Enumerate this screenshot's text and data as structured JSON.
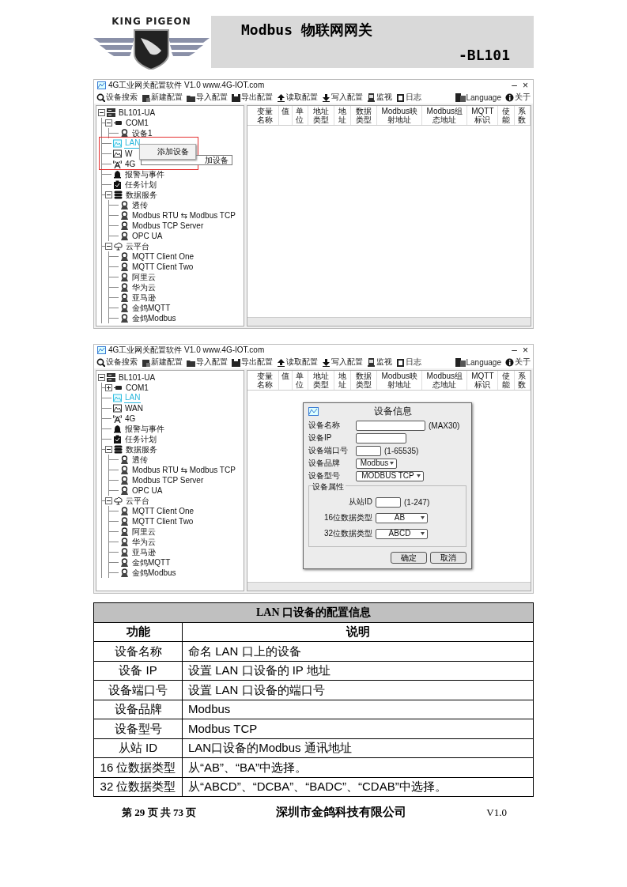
{
  "header": {
    "brand": "KING PIGEON",
    "title": "Modbus 物联网网关",
    "model": "-BL101"
  },
  "screenshots": [
    {
      "window_title": "4G工业网关配置软件 V1.0 www.4G-IOT.com",
      "window_controls": [
        "–",
        "×"
      ],
      "toolbar": [
        "设备搜索",
        "新建配置",
        "导入配置",
        "导出配置",
        "读取配置",
        "写入配置",
        "监视",
        "日志"
      ],
      "toolbar_right": [
        "Language",
        "关于"
      ],
      "tree": [
        {
          "label": "BL101-UA",
          "kind": "root",
          "selected": false,
          "expanded": true,
          "children": [
            {
              "label": "COM1",
              "kind": "serial",
              "selected": false,
              "expanded": true,
              "children": [
                {
                  "label": "设备1",
                  "kind": "device",
                  "selected": false
                }
              ]
            },
            {
              "label": "LAN",
              "kind": "lan",
              "selected": true
            },
            {
              "label": "W",
              "kind": "wan",
              "selected": false
            },
            {
              "label": "4G",
              "kind": "cell",
              "selected": false
            },
            {
              "label": "报警与事件",
              "kind": "alarm",
              "selected": false
            },
            {
              "label": "任务计划",
              "kind": "task",
              "selected": false
            },
            {
              "label": "数据服务",
              "kind": "database",
              "selected": false,
              "expanded": true,
              "children": [
                {
                  "label": "透传",
                  "kind": "device",
                  "selected": false
                },
                {
                  "label": "Modbus RTU ⇆ Modbus TCP",
                  "kind": "device",
                  "selected": false
                },
                {
                  "label": "Modbus TCP Server",
                  "kind": "device",
                  "selected": false
                },
                {
                  "label": "OPC UA",
                  "kind": "device",
                  "selected": false
                }
              ]
            },
            {
              "label": "云平台",
              "kind": "cloud",
              "selected": false,
              "expanded": true,
              "children": [
                {
                  "label": "MQTT Client One",
                  "kind": "device",
                  "selected": false
                },
                {
                  "label": "MQTT Client Two",
                  "kind": "device",
                  "selected": false
                },
                {
                  "label": "阿里云",
                  "kind": "device",
                  "selected": false
                },
                {
                  "label": "华为云",
                  "kind": "device",
                  "selected": false
                },
                {
                  "label": "亚马逊",
                  "kind": "device",
                  "selected": false
                },
                {
                  "label": "金鸽MQTT",
                  "kind": "device",
                  "selected": false
                },
                {
                  "label": "金鸽Modbus",
                  "kind": "device",
                  "selected": false
                }
              ]
            }
          ]
        }
      ],
      "columns": [
        "变量名称",
        "值",
        "单位",
        "地址类型",
        "地址",
        "数据类型",
        "Modbus映射地址",
        "Modbus组态地址",
        "MQTT标识",
        "使能",
        "系数"
      ],
      "context_menu": {
        "items": [
          "添加设备"
        ],
        "tooltip": "加设备"
      }
    },
    {
      "window_title": "4G工业网关配置软件 V1.0 www.4G-IOT.com",
      "window_controls": [
        "–",
        "×"
      ],
      "toolbar": [
        "设备搜索",
        "新建配置",
        "导入配置",
        "导出配置",
        "读取配置",
        "写入配置",
        "监视",
        "日志"
      ],
      "toolbar_right": [
        "Language",
        "关于"
      ],
      "tree": [
        {
          "label": "BL101-UA",
          "kind": "root",
          "selected": false,
          "expanded": true,
          "children": [
            {
              "label": "COM1",
              "kind": "serial",
              "selected": false,
              "expanded": false
            },
            {
              "label": "LAN",
              "kind": "lan",
              "selected": true
            },
            {
              "label": "WAN",
              "kind": "wan",
              "selected": false
            },
            {
              "label": "4G",
              "kind": "cell",
              "selected": false
            },
            {
              "label": "报警与事件",
              "kind": "alarm",
              "selected": false
            },
            {
              "label": "任务计划",
              "kind": "task",
              "selected": false
            },
            {
              "label": "数据服务",
              "kind": "database",
              "selected": false,
              "expanded": true,
              "children": [
                {
                  "label": "透传",
                  "kind": "device",
                  "selected": false
                },
                {
                  "label": "Modbus RTU ⇆ Modbus TCP",
                  "kind": "device",
                  "selected": false
                },
                {
                  "label": "Modbus TCP Server",
                  "kind": "device",
                  "selected": false
                },
                {
                  "label": "OPC UA",
                  "kind": "device",
                  "selected": false
                }
              ]
            },
            {
              "label": "云平台",
              "kind": "cloud",
              "selected": false,
              "expanded": true,
              "children": [
                {
                  "label": "MQTT Client One",
                  "kind": "device",
                  "selected": false
                },
                {
                  "label": "MQTT Client Two",
                  "kind": "device",
                  "selected": false
                },
                {
                  "label": "阿里云",
                  "kind": "device",
                  "selected": false
                },
                {
                  "label": "华为云",
                  "kind": "device",
                  "selected": false
                },
                {
                  "label": "亚马逊",
                  "kind": "device",
                  "selected": false
                },
                {
                  "label": "金鸽MQTT",
                  "kind": "device",
                  "selected": false
                },
                {
                  "label": "金鸽Modbus",
                  "kind": "device",
                  "selected": false
                }
              ]
            }
          ]
        }
      ],
      "columns": [
        "变量名称",
        "值",
        "单位",
        "地址类型",
        "地址",
        "数据类型",
        "Modbus映射地址",
        "Modbus组态地址",
        "MQTT标识",
        "使能",
        "系数"
      ],
      "dialog": {
        "title": "设备信息",
        "fields": [
          {
            "kind": "input",
            "label": "设备名称",
            "hint": "(MAX30)"
          },
          {
            "kind": "input",
            "label": "设备IP"
          },
          {
            "kind": "input",
            "label": "设备端口号",
            "hint": "(1-65535)"
          },
          {
            "kind": "select",
            "label": "设备品牌",
            "value": "Modbus"
          },
          {
            "kind": "select",
            "label": "设备型号",
            "value": "MODBUS TCP"
          }
        ],
        "group": {
          "title": "设备属性",
          "fields": [
            {
              "kind": "input",
              "label": "从站ID",
              "hint": "(1-247)"
            },
            {
              "kind": "select",
              "label": "16位数据类型",
              "value": "AB"
            },
            {
              "kind": "select",
              "label": "32位数据类型",
              "value": "ABCD"
            }
          ]
        },
        "buttons": [
          "确定",
          "取消"
        ]
      }
    }
  ],
  "table": {
    "title": "LAN 口设备的配置信息",
    "columns": [
      "功能",
      "说明"
    ],
    "rows": [
      [
        "设备名称",
        "命名 LAN 口上的设备"
      ],
      [
        "设备 IP",
        "设置 LAN 口设备的 IP 地址"
      ],
      [
        "设备端口号",
        "设置 LAN 口设备的端口号"
      ],
      [
        "设备品牌",
        "Modbus"
      ],
      [
        "设备型号",
        "Modbus TCP"
      ],
      [
        "从站 ID",
        "LAN口设备的Modbus  通讯地址"
      ],
      [
        "16 位数据类型",
        "从“AB”、“BA”中选择。"
      ],
      [
        "32 位数据类型",
        "从“ABCD”、“DCBA”、“BADC”、“CDAB”中选择。"
      ]
    ]
  },
  "footer": {
    "page": "第 29 页 共 73 页",
    "company": "深圳市金鸽科技有限公司",
    "version": "V1.0"
  }
}
